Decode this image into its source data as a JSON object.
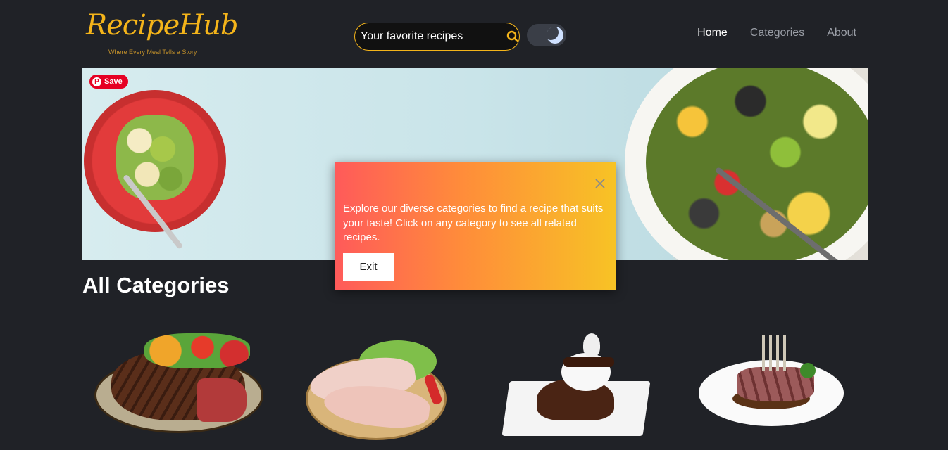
{
  "header": {
    "logo_title": "RecipeHub",
    "logo_tagline": "Where Every Meal Tells a Story",
    "search_value": "Your favorite recipes",
    "search_icon": "search-icon",
    "theme_toggle_icon": "moon-icon"
  },
  "nav": {
    "items": [
      {
        "label": "Home",
        "active": true
      },
      {
        "label": "Categories",
        "active": false
      },
      {
        "label": "About",
        "active": false
      }
    ]
  },
  "hero": {
    "pinterest_save_label": "Save",
    "pinterest_icon": "pinterest-icon"
  },
  "section": {
    "title": "All Categories"
  },
  "popup": {
    "message": "Explore our diverse categories to find a recipe that suits your taste! Click on any category to see all related recipes.",
    "exit_label": "Exit",
    "close_icon": "close-icon"
  },
  "categories": [
    {
      "image": "steak-plate"
    },
    {
      "image": "chicken-plate"
    },
    {
      "image": "chocolate-dessert"
    },
    {
      "image": "lamb-chops-plate"
    }
  ],
  "colors": {
    "background": "#202227",
    "accent": "#f4b41a",
    "popup_gradient_start": "#ff5a5a",
    "popup_gradient_end": "#f7c325",
    "pinterest": "#e60023"
  }
}
